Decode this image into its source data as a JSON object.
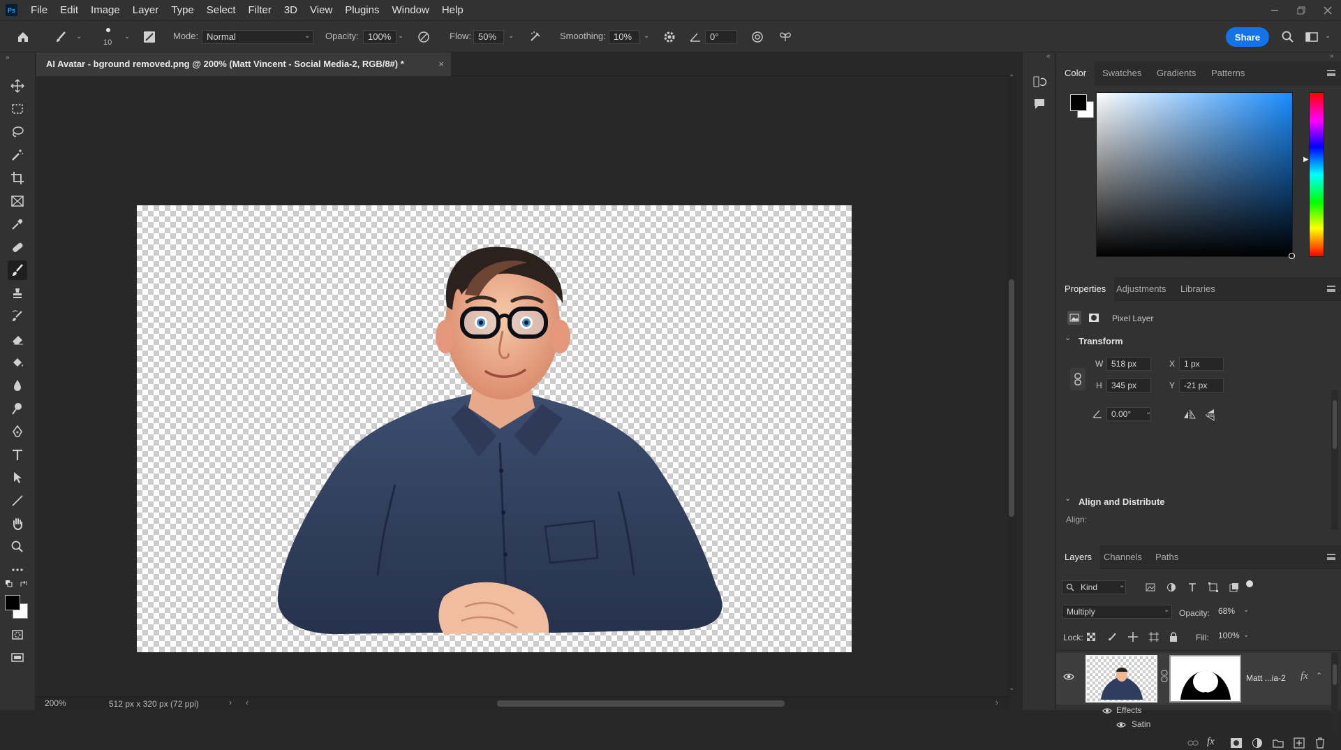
{
  "app": {
    "logo": "Ps"
  },
  "menu": [
    "File",
    "Edit",
    "Image",
    "Layer",
    "Type",
    "Select",
    "Filter",
    "3D",
    "View",
    "Plugins",
    "Window",
    "Help"
  ],
  "options": {
    "brush_size": "10",
    "mode_label": "Mode:",
    "mode_value": "Normal",
    "opacity_label": "Opacity:",
    "opacity_value": "100%",
    "flow_label": "Flow:",
    "flow_value": "50%",
    "smoothing_label": "Smoothing:",
    "smoothing_value": "10%",
    "angle_value": "0°",
    "share_label": "Share"
  },
  "document": {
    "tab_title": "AI Avatar - bground removed.png @ 200% (Matt Vincent - Social Media-2, RGB/8#) *",
    "close_glyph": "×"
  },
  "status": {
    "zoom": "200%",
    "doc_info": "512 px x 320 px (72 ppi)"
  },
  "color_panel": {
    "tabs": [
      "Color",
      "Swatches",
      "Gradients",
      "Patterns"
    ],
    "foreground": "#000000",
    "background": "#ffffff"
  },
  "properties_panel": {
    "tabs": [
      "Properties",
      "Adjustments",
      "Libraries"
    ],
    "kind": "Pixel Layer",
    "transform_title": "Transform",
    "w_label": "W",
    "w_value": "518 px",
    "h_label": "H",
    "h_value": "345 px",
    "x_label": "X",
    "x_value": "1 px",
    "y_label": "Y",
    "y_value": "-21 px",
    "angle_value": "0.00°",
    "align_title": "Align and Distribute",
    "align_label": "Align:"
  },
  "layers_panel": {
    "tabs": [
      "Layers",
      "Channels",
      "Paths"
    ],
    "filter_kind": "Kind",
    "blend_mode": "Multiply",
    "opacity_label": "Opacity:",
    "opacity_value": "68%",
    "lock_label": "Lock:",
    "fill_label": "Fill:",
    "fill_value": "100%",
    "layer_name": "Matt ...ia-2",
    "fx_glyph": "fx",
    "effects_label": "Effects",
    "satin_label": "Satin"
  },
  "colors": {
    "accent": "#1473e6",
    "panel": "#323232",
    "workspace": "#282828"
  }
}
